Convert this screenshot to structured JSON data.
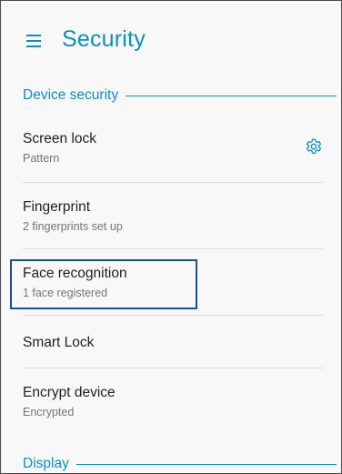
{
  "header": {
    "title": "Security",
    "menu_icon": "hamburger-menu-icon"
  },
  "sections": {
    "device_security": {
      "title": "Device security"
    },
    "display": {
      "title": "Display"
    }
  },
  "items": {
    "screen_lock": {
      "title": "Screen lock",
      "summary": "Pattern",
      "icon": "gear-icon"
    },
    "fingerprint": {
      "title": "Fingerprint",
      "summary": "2 fingerprints set up"
    },
    "face_recognition": {
      "title": "Face recognition",
      "summary": "1 face registered",
      "highlighted": true
    },
    "smart_lock": {
      "title": "Smart Lock"
    },
    "encrypt_device": {
      "title": "Encrypt device",
      "summary": "Encrypted"
    }
  },
  "colors": {
    "accent": "#0a8fbf",
    "highlight_border": "#1e4f86",
    "primary_text": "#212121",
    "secondary_text": "#757575"
  }
}
